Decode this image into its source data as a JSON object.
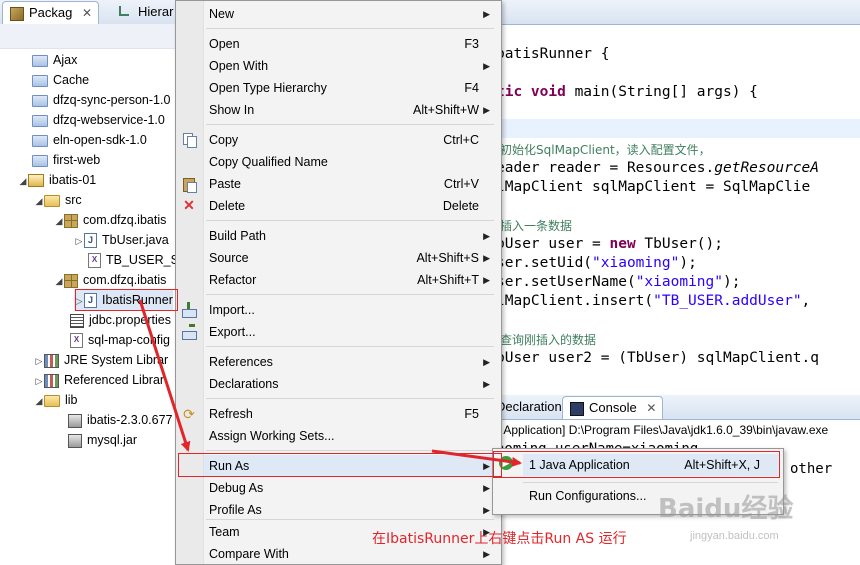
{
  "explorer": {
    "tabs": [
      {
        "label": "Packag",
        "close": "✕"
      },
      {
        "label": "Hierar"
      }
    ],
    "items": [
      {
        "label": "Ajax"
      },
      {
        "label": "Cache"
      },
      {
        "label": "dfzq-sync-person-1.0"
      },
      {
        "label": "dfzq-webservice-1.0"
      },
      {
        "label": "eln-open-sdk-1.0"
      },
      {
        "label": "first-web"
      },
      {
        "label": "ibatis-01"
      },
      {
        "label": "src"
      },
      {
        "label": "com.dfzq.ibatis"
      },
      {
        "label": "TbUser.java"
      },
      {
        "label": "TB_USER_Sc"
      },
      {
        "label": "com.dfzq.ibatis"
      },
      {
        "label": "IbatisRunner"
      },
      {
        "label": "jdbc.properties"
      },
      {
        "label": "sql-map-config"
      },
      {
        "label": "JRE System Librar"
      },
      {
        "label": "Referenced Librar"
      },
      {
        "label": "lib"
      },
      {
        "label": "ibatis-2.3.0.677"
      },
      {
        "label": "mysql.jar"
      }
    ]
  },
  "editor": {
    "lines": [
      {
        "t": "batisRunner {"
      },
      {
        "kw": "tic void",
        "t": " main(String[] args) {"
      },
      {
        "cmt": "/初始化SqlMapClient，读入配置文件，"
      },
      {
        "t": "eader reader = Resources.",
        "it": "getResourceA"
      },
      {
        "t": "lMapClient sqlMapClient = SqlMapClie"
      },
      {
        "cmt": "/插入一条数据"
      },
      {
        "t": "bUser user = ",
        "kw": "new",
        "t2": " TbUser();"
      },
      {
        "t": "ser.setUid(",
        "str": "\"xiaoming\"",
        "t2": ");"
      },
      {
        "t": "ser.setUserName(",
        "str": "\"xiaoming\"",
        "t2": ");"
      },
      {
        "t": "lMapClient.insert(",
        "str": "\"TB_USER.addUser\"",
        "t2": ","
      },
      {
        "cmt": "/查询刚插入的数据"
      },
      {
        "t": "bUser user2 = (TbUser) sqlMapClient.q"
      }
    ]
  },
  "console": {
    "tab_declaration": "Declaration",
    "tab_console": "Console",
    "close": "✕",
    "path": "a Application] D:\\Program Files\\Java\\jdk1.6.0_39\\bin\\javaw.exe",
    "out1": "aoming userName=xiaoming",
    "out2": "other"
  },
  "context_menu": {
    "items": [
      {
        "label": "New",
        "shortcut": "",
        "submenu": true
      },
      {
        "label": "Open",
        "shortcut": "F3"
      },
      {
        "label": "Open With",
        "shortcut": "",
        "submenu": true
      },
      {
        "label": "Open Type Hierarchy",
        "shortcut": "F4"
      },
      {
        "label": "Show In",
        "shortcut": "Alt+Shift+W",
        "submenu": true
      },
      {
        "label": "Copy",
        "shortcut": "Ctrl+C",
        "icon": "copy-icon"
      },
      {
        "label": "Copy Qualified Name",
        "shortcut": ""
      },
      {
        "label": "Paste",
        "shortcut": "Ctrl+V",
        "icon": "paste-icon"
      },
      {
        "label": "Delete",
        "shortcut": "Delete",
        "icon": "delete-icon"
      },
      {
        "label": "Build Path",
        "shortcut": "",
        "submenu": true
      },
      {
        "label": "Source",
        "shortcut": "Alt+Shift+S",
        "submenu": true
      },
      {
        "label": "Refactor",
        "shortcut": "Alt+Shift+T",
        "submenu": true
      },
      {
        "label": "Import...",
        "shortcut": "",
        "icon": "import-icon"
      },
      {
        "label": "Export...",
        "shortcut": "",
        "icon": "export-icon"
      },
      {
        "label": "References",
        "shortcut": "",
        "submenu": true
      },
      {
        "label": "Declarations",
        "shortcut": "",
        "submenu": true
      },
      {
        "label": "Refresh",
        "shortcut": "F5",
        "icon": "refresh-icon"
      },
      {
        "label": "Assign Working Sets...",
        "shortcut": ""
      },
      {
        "label": "Run As",
        "shortcut": "",
        "submenu": true
      },
      {
        "label": "Debug As",
        "shortcut": "",
        "submenu": true
      },
      {
        "label": "Profile As",
        "shortcut": "",
        "submenu": true
      },
      {
        "label": "Team",
        "shortcut": "",
        "submenu": true
      },
      {
        "label": "Compare With",
        "shortcut": "",
        "submenu": true
      }
    ]
  },
  "submenu": {
    "items": [
      {
        "label": "1 Java Application",
        "shortcut": "Alt+Shift+X, J"
      },
      {
        "label": "Run Configurations..."
      }
    ]
  },
  "annotation": {
    "caption": "在IbatisRunner上右键点击Run AS 运行",
    "color": "#e0262b"
  },
  "watermark": {
    "text": "Baidu经验",
    "url": "jingyan.baidu.com"
  }
}
